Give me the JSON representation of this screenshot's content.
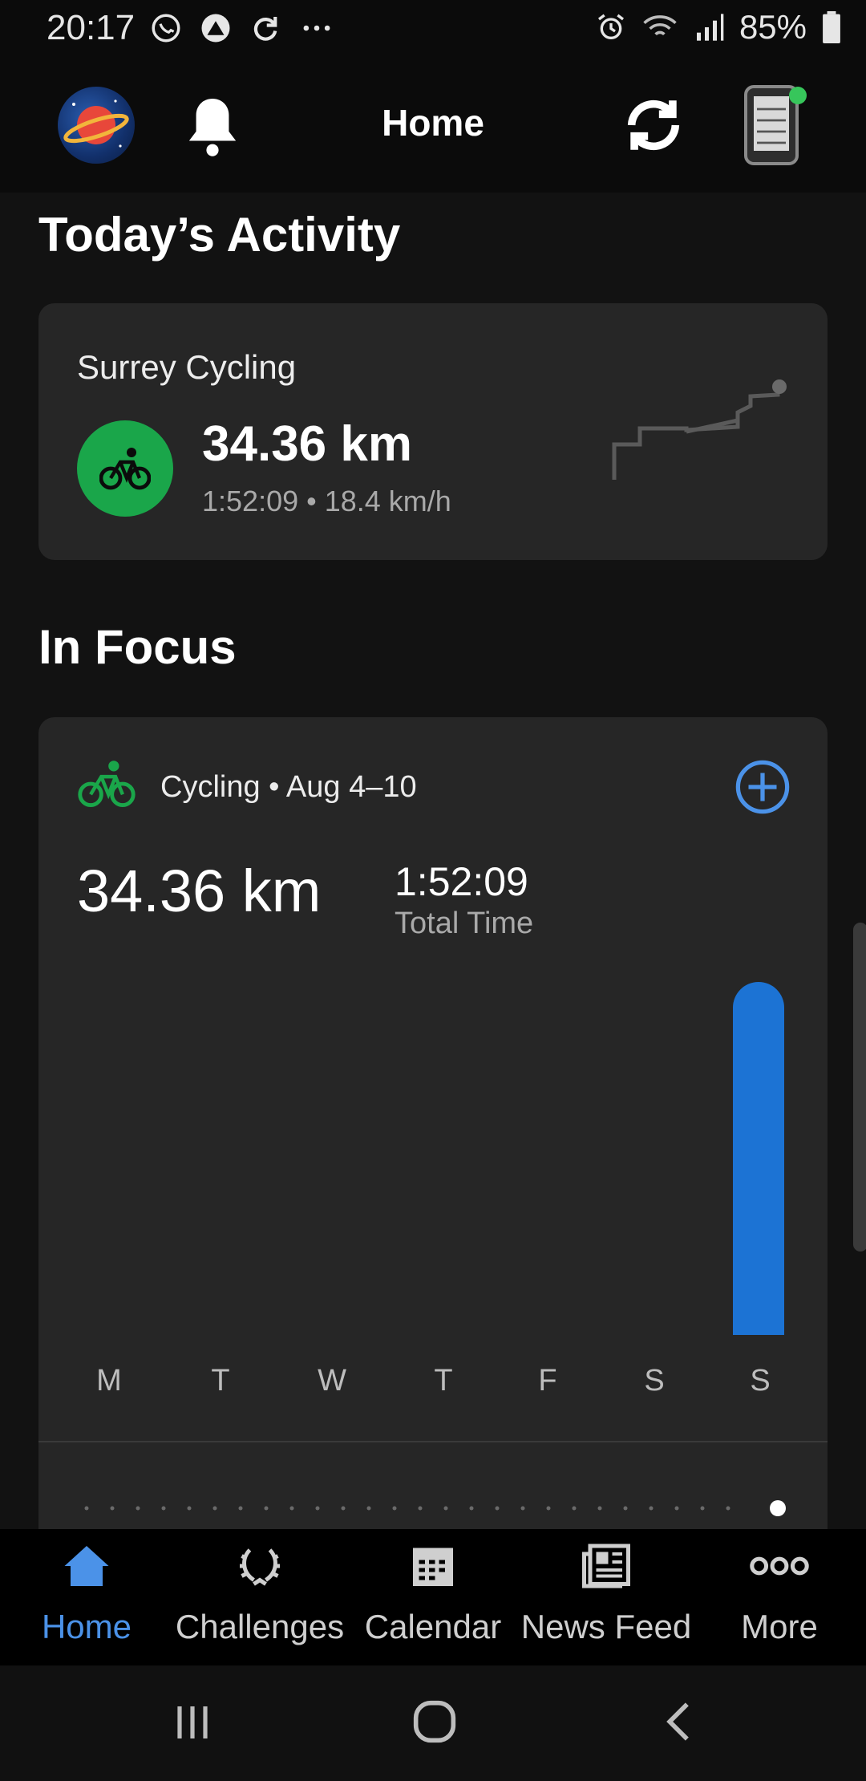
{
  "status_bar": {
    "time": "20:17",
    "left_icons": [
      "whatsapp-icon",
      "app-icon",
      "sync-icon",
      "more-dots-icon"
    ],
    "right_icons": [
      "alarm-icon",
      "wifi-icon",
      "signal-icon"
    ],
    "battery": "85%"
  },
  "app_bar": {
    "title": "Home"
  },
  "todays_activity": {
    "heading": "Today’s Activity",
    "name": "Surrey Cycling",
    "distance": "34.36 km",
    "meta": "1:52:09 • 18.4 km/h",
    "icon": "bike-icon"
  },
  "in_focus": {
    "heading": "In Focus",
    "label": "Cycling • Aug 4–10",
    "distance": "34.36 km",
    "time_value": "1:52:09",
    "time_label": "Total Time",
    "days": [
      "M",
      "T",
      "W",
      "T",
      "F",
      "S",
      "S"
    ],
    "bar_color": "#1c73d4"
  },
  "bottom_nav": [
    {
      "label": "Home",
      "icon": "home-icon",
      "active": true
    },
    {
      "label": "Challenges",
      "icon": "laurel-icon",
      "active": false
    },
    {
      "label": "Calendar",
      "icon": "calendar-icon",
      "active": false
    },
    {
      "label": "News Feed",
      "icon": "news-icon",
      "active": false
    },
    {
      "label": "More",
      "icon": "more-icon",
      "active": false
    }
  ],
  "colors": {
    "accent": "#4b92e8",
    "green": "#1aa64a",
    "card": "#262626",
    "background": "#121212"
  }
}
